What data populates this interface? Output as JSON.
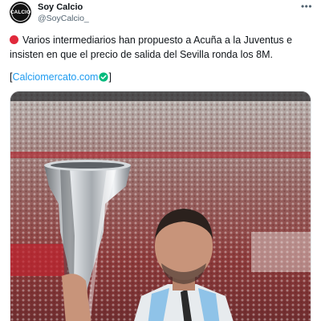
{
  "author": {
    "display_name": "Soy Calcio",
    "handle": "@SoyCalcio_",
    "avatar_text": "CALCIO"
  },
  "more_icon": "more-horizontal-icon",
  "tweet": {
    "status_icon": "red-circle",
    "text": "Varios intermediarios han propuesto a Acuña a la Juventus e insisten en que el precio de salida del Sevilla ronda los 8M.",
    "link_open": "[",
    "link_text": "Calciomercato.com",
    "link_close": "]",
    "link_badge_icon": "verified-check-icon"
  },
  "media": {
    "kind": "photo",
    "subject": "Player holding the Europa League trophy in a stadium full of fans"
  },
  "colors": {
    "link": "#1d9bf0",
    "secondary_text": "#536471",
    "status_red": "#e0293b",
    "verified_green": "#00ba7c"
  }
}
